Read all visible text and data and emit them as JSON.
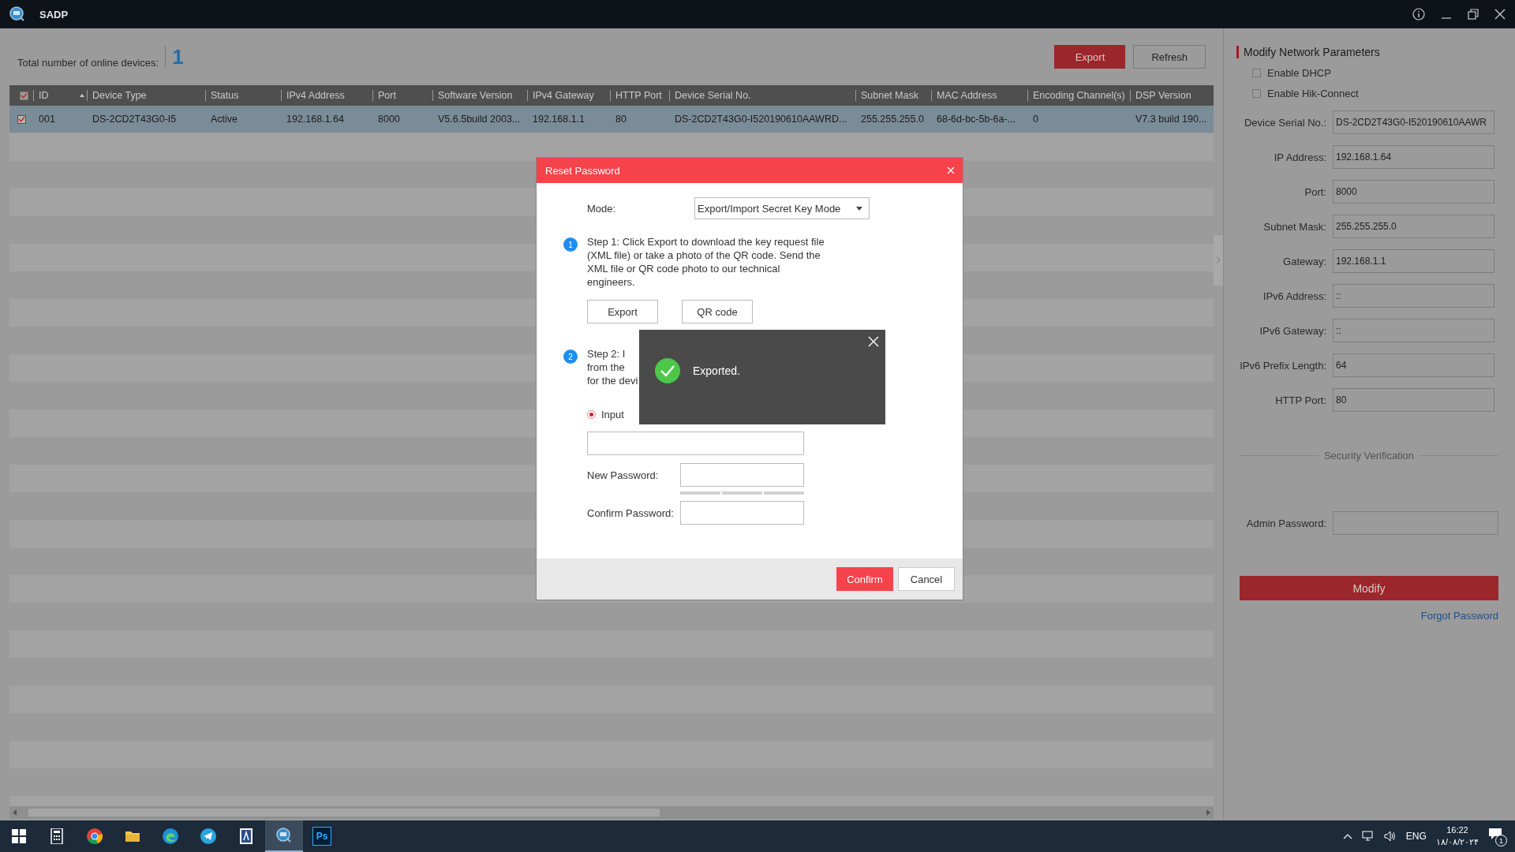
{
  "window": {
    "title": "SADP"
  },
  "summary": {
    "label": "Total number of online devices:",
    "count": "1"
  },
  "toolbar": {
    "buttons": [
      {
        "label": "Export",
        "kind": "primary"
      },
      {
        "label": "Refresh",
        "kind": "secondary"
      }
    ]
  },
  "table": {
    "all_checked": true,
    "columns": [
      "ID",
      "Device Type",
      "Status",
      "IPv4 Address",
      "Port",
      "Software Version",
      "IPv4 Gateway",
      "HTTP Port",
      "Device Serial No.",
      "Subnet Mask",
      "MAC Address",
      "Encoding Channel(s)",
      "DSP Version"
    ],
    "rows": [
      {
        "checked": true,
        "selected": true,
        "cells": [
          "001",
          "DS-2CD2T43G0-I5",
          "Active",
          "192.168.1.64",
          "8000",
          "V5.6.5build 2003...",
          "192.168.1.1",
          "80",
          "DS-2CD2T43G0-I520190610AAWRD...",
          "255.255.255.0",
          "68-6d-bc-5b-6a-...",
          "0",
          "V7.3 build 190..."
        ]
      }
    ]
  },
  "panel": {
    "title": "Modify Network Parameters",
    "options": [
      {
        "label": "Enable DHCP",
        "checked": false
      },
      {
        "label": "Enable Hik-Connect",
        "checked": false
      }
    ],
    "fields": [
      {
        "label": "Device Serial No.:",
        "value": "DS-2CD2T43G0-I520190610AAWR"
      },
      {
        "label": "IP Address:",
        "value": "192.168.1.64"
      },
      {
        "label": "Port:",
        "value": "8000"
      },
      {
        "label": "Subnet Mask:",
        "value": "255.255.255.0"
      },
      {
        "label": "Gateway:",
        "value": "192.168.1.1"
      },
      {
        "label": "IPv6 Address:",
        "value": "::"
      },
      {
        "label": "IPv6 Gateway:",
        "value": "::"
      },
      {
        "label": "IPv6 Prefix Length:",
        "value": "64"
      },
      {
        "label": "HTTP Port:",
        "value": "80"
      }
    ],
    "section": "Security Verification",
    "password_label": "Admin Password:",
    "submit": "Modify",
    "link": "Forgot Password"
  },
  "dialog": {
    "title": "Reset Password",
    "mode": {
      "label": "Mode:",
      "value": "Export/Import Secret Key Mode"
    },
    "steps": [
      {
        "number": "1",
        "text": "Step 1: Click Export to download the key request file (XML file) or take a photo of the QR code. Send the XML file or QR code photo to our technical engineers."
      },
      {
        "number": "2",
        "text": "Step 2: I\nfrom the\nfor the devi"
      }
    ],
    "step_buttons": [
      "Export",
      "QR code"
    ],
    "choices": [
      {
        "label": "Input",
        "selected": true
      }
    ],
    "new_password": "New Password:",
    "confirm_password": "Confirm Password:",
    "buttons": [
      {
        "label": "Confirm",
        "kind": "primary"
      },
      {
        "label": "Cancel",
        "kind": "secondary"
      }
    ]
  },
  "toast": {
    "message": "Exported."
  },
  "taskbar": {
    "apps": [
      {
        "kind": "start",
        "selected": false
      },
      {
        "kind": "calculator",
        "selected": false
      },
      {
        "kind": "chrome",
        "selected": false
      },
      {
        "kind": "folder",
        "selected": false
      },
      {
        "kind": "edge",
        "selected": false
      },
      {
        "kind": "telegram",
        "selected": false
      },
      {
        "kind": "document",
        "selected": false
      },
      {
        "kind": "sadp",
        "selected": true
      },
      {
        "kind": "photoshop",
        "label": "Ps",
        "selected": false
      }
    ],
    "language": "ENG",
    "time": "16:22",
    "date": "۱۸/۰۸/۲۰۲۴",
    "notifications": "1"
  }
}
